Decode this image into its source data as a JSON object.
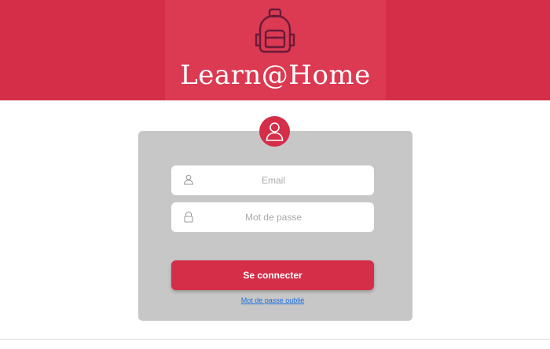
{
  "header": {
    "title": "Learn@Home",
    "logo_icon": "backpack-icon"
  },
  "login": {
    "avatar_icon": "user-icon",
    "email": {
      "placeholder": "Email",
      "value": "",
      "icon": "user-icon"
    },
    "password": {
      "placeholder": "Mot de passe",
      "value": "",
      "icon": "lock-icon"
    },
    "submit_label": "Se connecter",
    "forgot_label": "Mot de passe oublié"
  },
  "colors": {
    "brand": "#d42e48",
    "brand_panel": "#db3a52",
    "logo_stroke": "#6b1a3a",
    "card": "#c7c7c7",
    "link": "#1a6fe0"
  }
}
